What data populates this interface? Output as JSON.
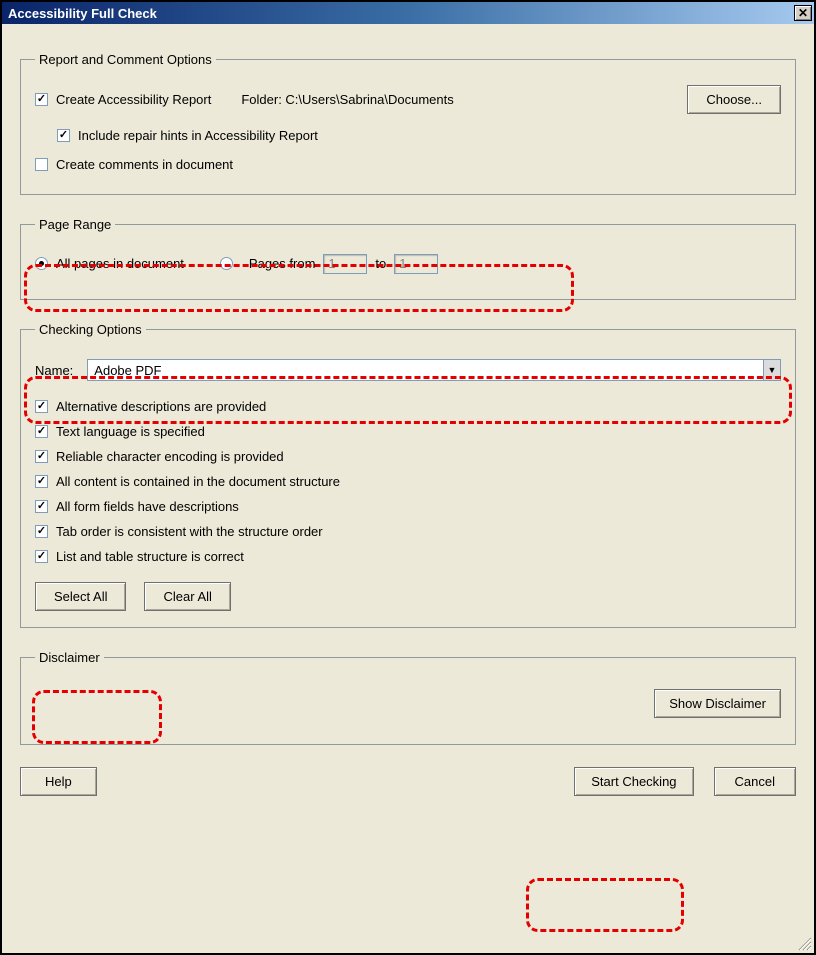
{
  "title": "Accessibility Full Check",
  "report": {
    "legend": "Report and Comment Options",
    "create_report_label": "Create Accessibility Report",
    "create_report_checked": true,
    "folder_label": "Folder: C:\\Users\\Sabrina\\Documents",
    "choose_label": "Choose...",
    "include_hints_label": "Include repair hints in Accessibility Report",
    "include_hints_checked": true,
    "create_comments_label": "Create comments in document",
    "create_comments_checked": false
  },
  "page_range": {
    "legend": "Page Range",
    "all_pages_label": "All pages in document",
    "pages_from_label": "Pages from",
    "to_label": "to",
    "from_value": "1",
    "to_value": "1",
    "selected": "all"
  },
  "checking": {
    "legend": "Checking Options",
    "name_label": "Name:",
    "name_value": "Adobe PDF",
    "options": [
      {
        "label": "Alternative descriptions are provided",
        "checked": true
      },
      {
        "label": "Text language is specified",
        "checked": true
      },
      {
        "label": "Reliable character encoding is provided",
        "checked": true
      },
      {
        "label": "All content is contained in the document structure",
        "checked": true
      },
      {
        "label": "All form fields have descriptions",
        "checked": true
      },
      {
        "label": "Tab order is consistent with the structure order",
        "checked": true
      },
      {
        "label": "List and table structure is correct",
        "checked": true
      }
    ],
    "select_all_label": "Select All",
    "clear_all_label": "Clear All"
  },
  "disclaimer": {
    "legend": "Disclaimer",
    "show_label": "Show Disclaimer"
  },
  "buttons": {
    "help": "Help",
    "start": "Start Checking",
    "cancel": "Cancel"
  }
}
